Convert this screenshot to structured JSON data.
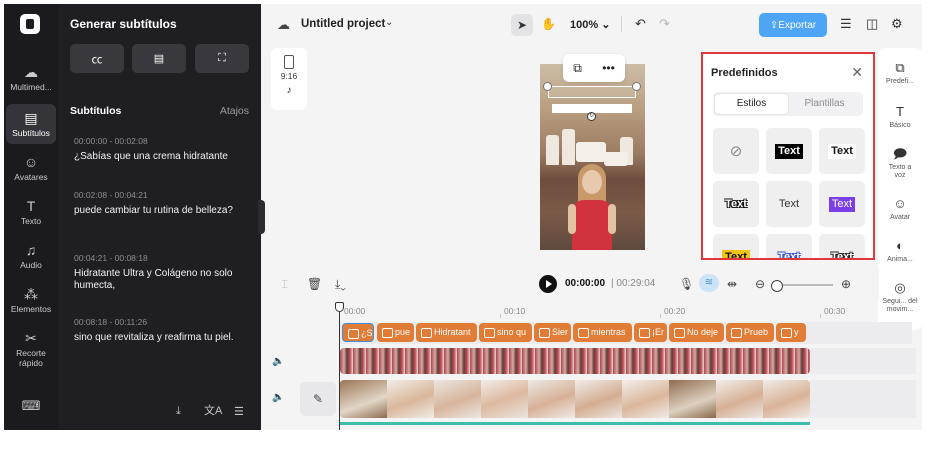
{
  "rail": {
    "items": [
      {
        "label": "Multimed...",
        "icon": "cloud-upload-icon",
        "glyph": "☁"
      },
      {
        "label": "Subtítulos",
        "icon": "subtitles-icon",
        "glyph": "▤"
      },
      {
        "label": "Avatares",
        "icon": "avatar-icon",
        "glyph": "☺"
      },
      {
        "label": "Texto",
        "icon": "text-icon",
        "glyph": "T"
      },
      {
        "label": "Audio",
        "icon": "music-icon",
        "glyph": "♫"
      },
      {
        "label": "Elementos",
        "icon": "elements-icon",
        "glyph": "⁂"
      },
      {
        "label": "Recorte rápido",
        "icon": "quick-cut-icon",
        "glyph": "✂"
      }
    ],
    "bottom_icon": "keyboard-icon"
  },
  "subtitles_panel": {
    "title": "Generar subtítulos",
    "section_title": "Subtítulos",
    "shortcuts_label": "Atajos",
    "cues": [
      {
        "time": "00:00:00 - 00:02:08",
        "text": "¿Sabías que una crema hidratante"
      },
      {
        "time": "00:02:08 - 00:04:21",
        "text": "puede cambiar tu rutina de belleza?"
      },
      {
        "time": "00:04:21 - 00:08:18",
        "text": "Hidratante Ultra y Colágeno no solo humecta,"
      },
      {
        "time": "00:08:18 - 00:11:26",
        "text": "sino que revitaliza y reafirma tu piel."
      }
    ]
  },
  "topbar": {
    "project_title": "Untitled project",
    "zoom": "100%",
    "export_label": "Exportar"
  },
  "aspect": {
    "ratio": "9:16"
  },
  "presets": {
    "title": "Predefinidos",
    "tabs": [
      {
        "label": "Estilos",
        "active": true
      },
      {
        "label": "Plantillas",
        "active": false
      }
    ],
    "items": [
      {
        "label": "",
        "kind": "none"
      },
      {
        "label": "Text",
        "bg": "#000000",
        "fg": "#ffffff"
      },
      {
        "label": "Text",
        "bg": "#ffffff",
        "fg": "#111111"
      },
      {
        "label": "Text",
        "bg": "#efefef",
        "fg": "#111111",
        "style": "outline"
      },
      {
        "label": "Text",
        "bg": "#efefef",
        "fg": "#333333"
      },
      {
        "label": "Text",
        "bg": "#7a3de6",
        "fg": "#ffffff"
      },
      {
        "label": "Text",
        "bg": "#f0c419",
        "fg": "#111111"
      },
      {
        "label": "Text",
        "bg": "#efefef",
        "fg": "#2f4fd6",
        "style": "outline"
      },
      {
        "label": "Text",
        "bg": "#efefef",
        "fg": "#222222",
        "style": "outline"
      }
    ]
  },
  "right_rail": {
    "items": [
      {
        "label": "Predefi...",
        "icon": "presets-icon",
        "glyph": "⧉"
      },
      {
        "label": "Básico",
        "icon": "text-basic-icon",
        "glyph": "T"
      },
      {
        "label": "Texto a voz",
        "icon": "text-to-speech-icon",
        "glyph": "🗩"
      },
      {
        "label": "Avatar",
        "icon": "avatar-icon",
        "glyph": "☺"
      },
      {
        "label": "Anima...",
        "icon": "animation-icon",
        "glyph": "◐"
      },
      {
        "label": "Segui... del movim...",
        "icon": "motion-tracking-icon",
        "glyph": "◎"
      }
    ]
  },
  "timeline": {
    "current_time": "00:00:00",
    "total_time": "00:29:04",
    "ruler_labels": [
      "00:00",
      "00:10",
      "00:20",
      "00:30"
    ],
    "subtitle_chips": [
      "¿Sabí",
      "pue",
      "Hidratant",
      "sino qu",
      "Sier",
      "mientras",
      "¡Er",
      "No deje",
      "Prueb",
      "y"
    ]
  },
  "colors": {
    "accent": "#4ea4f5",
    "chip": "#e07c35",
    "highlight_border": "#e2373a",
    "waveform": "#3ebea8"
  }
}
